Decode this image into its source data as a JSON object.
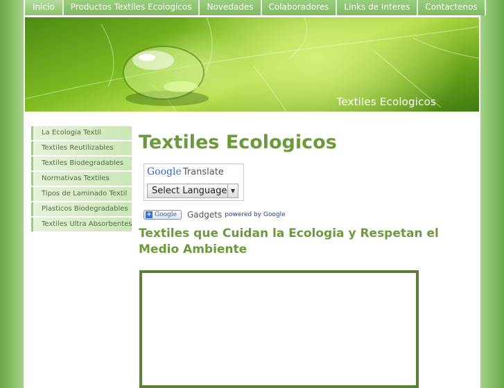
{
  "nav": {
    "items": [
      {
        "label": "Inicio"
      },
      {
        "label": "Productos Textiles Ecologicos"
      },
      {
        "label": "Novedades"
      },
      {
        "label": "Colaboradores"
      },
      {
        "label": "Links de Interes"
      },
      {
        "label": "Contactenos"
      }
    ]
  },
  "banner": {
    "title": "Textiles Ecologicos"
  },
  "sidebar": {
    "items": [
      {
        "label": "La Ecologia Textil"
      },
      {
        "label": "Textiles Reutilizables"
      },
      {
        "label": "Textiles Biodegradables"
      },
      {
        "label": "Normativas Textiles"
      },
      {
        "label": "Tipos de Laminado Textil"
      },
      {
        "label": "Plasticos Biodegradables"
      },
      {
        "label": "Textiles Ultra Absorbentes"
      }
    ]
  },
  "main": {
    "title": "Textiles Ecologicos",
    "translate": {
      "brand": "Google",
      "label": "Translate",
      "select": "Select Language"
    },
    "gadgets": {
      "button": "Google",
      "label": "Gadgets",
      "powered": "powered by Google"
    },
    "subtitle": "Textiles que Cuidan la Ecologia y Respetan el Medio Ambiente"
  },
  "colors": {
    "accent_green": "#6a9a3c",
    "nav_green": "#8cc36c",
    "frame_green": "#5a7f36"
  }
}
